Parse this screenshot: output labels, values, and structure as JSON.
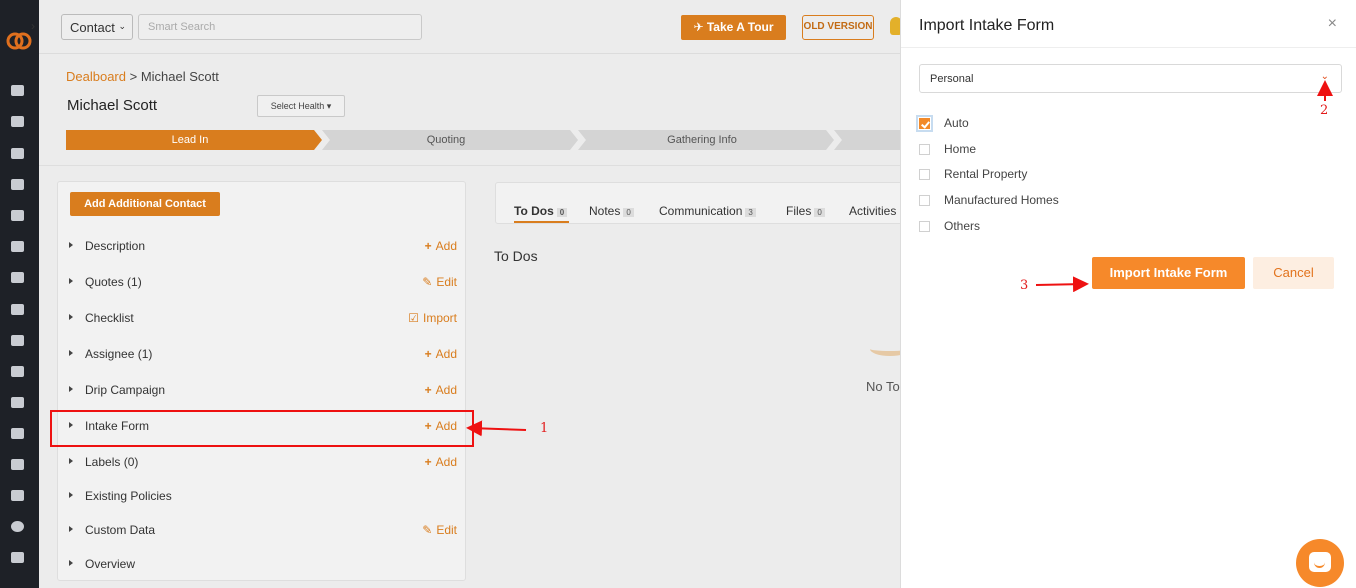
{
  "topbar": {
    "contact_select": "Contact",
    "search_placeholder": "Smart Search",
    "tour_label": "Take A Tour",
    "old_version_label": "OLD VERSION"
  },
  "breadcrumb": {
    "parent": "Dealboard",
    "separator": ">",
    "current": "Michael Scott"
  },
  "page_title": "Michael Scott",
  "health_select": "Select Health",
  "pipeline": {
    "stages": [
      "Lead In",
      "Quoting",
      "Gathering Info"
    ],
    "active_index": 0
  },
  "left_card": {
    "add_contact_label": "Add Additional Contact",
    "sections": [
      {
        "label": "Description",
        "action": "Add",
        "icon": "plus-icon"
      },
      {
        "label": "Quotes (1)",
        "action": "Edit",
        "icon": "pencil-icon"
      },
      {
        "label": "Checklist",
        "action": "Import",
        "icon": "import-icon"
      },
      {
        "label": "Assignee (1)",
        "action": "Add",
        "icon": "plus-icon"
      },
      {
        "label": "Drip Campaign",
        "action": "Add",
        "icon": "plus-icon"
      },
      {
        "label": "Intake Form",
        "action": "Add",
        "icon": "plus-icon"
      },
      {
        "label": "Labels (0)",
        "action": "Add",
        "icon": "plus-icon"
      },
      {
        "label": "Existing Policies",
        "action": "",
        "icon": ""
      },
      {
        "label": "Custom Data",
        "action": "Edit",
        "icon": "pencil-icon"
      },
      {
        "label": "Overview",
        "action": "",
        "icon": ""
      }
    ]
  },
  "mid_panel": {
    "tabs": [
      {
        "label": "To Dos",
        "count": "0"
      },
      {
        "label": "Notes",
        "count": "0"
      },
      {
        "label": "Communication",
        "count": "3"
      },
      {
        "label": "Files",
        "count": "0"
      },
      {
        "label": "Activities",
        "count": ""
      }
    ],
    "heading": "To Dos",
    "empty_text": "No To"
  },
  "modal": {
    "title": "Import Intake Form",
    "type_select": "Personal",
    "options": [
      {
        "label": "Auto",
        "checked": true
      },
      {
        "label": "Home",
        "checked": false
      },
      {
        "label": "Rental Property",
        "checked": false
      },
      {
        "label": "Manufactured Homes",
        "checked": false
      },
      {
        "label": "Others",
        "checked": false
      }
    ],
    "import_label": "Import Intake Form",
    "cancel_label": "Cancel"
  },
  "annotations": {
    "step1": "1",
    "step2": "2",
    "step3": "3"
  },
  "colors": {
    "brand_orange": "#d97d1e",
    "annotation_red": "#ee1111",
    "rail_dark": "#1e2127"
  }
}
